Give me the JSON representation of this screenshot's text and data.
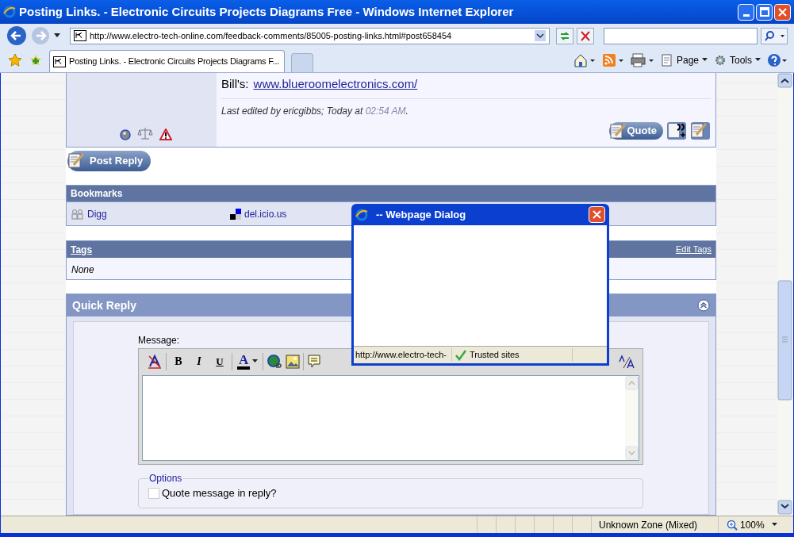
{
  "window": {
    "title": "Posting Links. - Electronic Circuits Projects Diagrams Free - Windows Internet Explorer"
  },
  "address_bar": {
    "url": "http://www.electro-tech-online.com/feedback-comments/85005-posting-links.html#post658454"
  },
  "tabs": [
    {
      "label": "Posting Links. - Electronic Circuits Projects Diagrams F...",
      "selected": true
    }
  ],
  "command_bar": [
    {
      "label": "Page"
    },
    {
      "label": "Tools"
    }
  ],
  "post": {
    "signature_label": "Bill's:",
    "signature_link": "www.blueroomelectronics.com/",
    "edit_note_prefix": "Last edited by ericgibbs; Today at",
    "edit_time": "02:54 AM",
    "edit_note_suffix": ".",
    "quote_button": "Quote"
  },
  "post_reply_button": "Post Reply",
  "bookmarks": {
    "title": "Bookmarks",
    "items": [
      {
        "label": "Digg"
      },
      {
        "label": "del.icio.us"
      }
    ]
  },
  "tags": {
    "title": "Tags",
    "edit_link": "Edit Tags",
    "value": "None"
  },
  "quick_reply": {
    "title": "Quick Reply",
    "message_label": "Message:",
    "toolbar": [
      {
        "kind": "remove-format"
      },
      {
        "kind": "bold",
        "label": "B"
      },
      {
        "kind": "italic",
        "label": "I"
      },
      {
        "kind": "underline",
        "label": "U"
      },
      {
        "kind": "text-color",
        "label": "A"
      },
      {
        "kind": "link"
      },
      {
        "kind": "image"
      },
      {
        "kind": "quote"
      }
    ],
    "options_legend": "Options",
    "options": [
      {
        "label": "Quote message in reply?",
        "checked": false
      }
    ]
  },
  "dialog": {
    "title": "-- Webpage Dialog",
    "status_url": "http://www.electro-tech-",
    "zone": "Trusted sites"
  },
  "status_bar": {
    "zone": "Unknown Zone (Mixed)",
    "zoom": "100%"
  }
}
